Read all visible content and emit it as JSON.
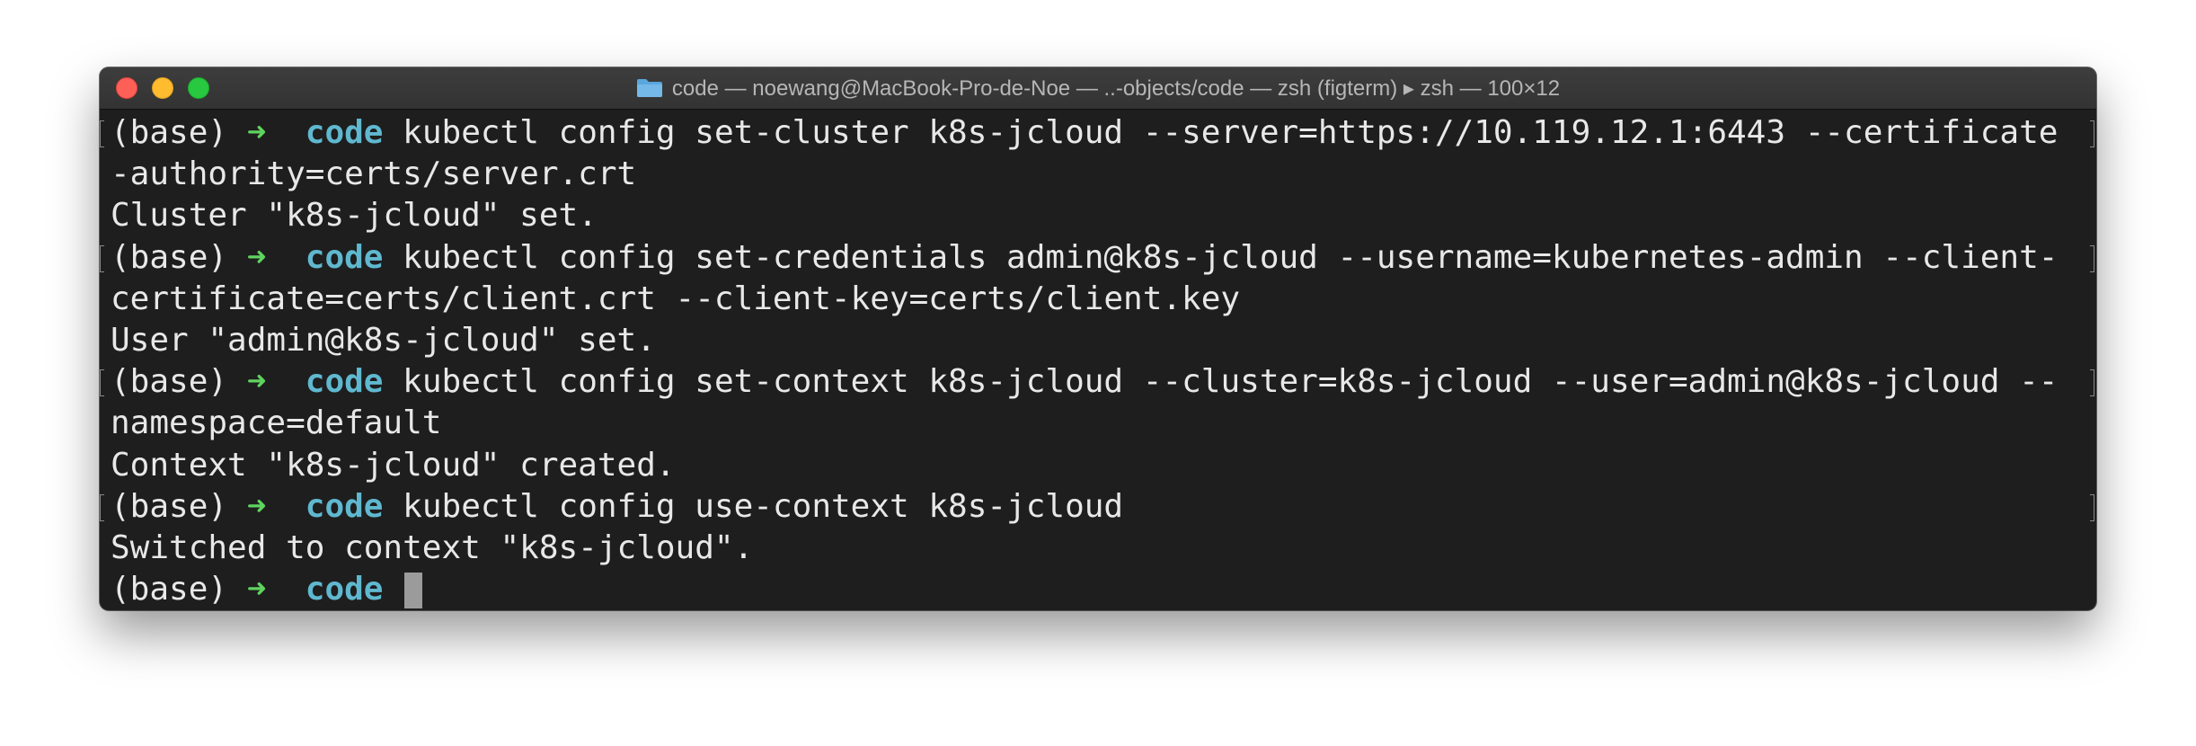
{
  "window": {
    "title": "code — noewang@MacBook-Pro-de-Noe — ..-objects/code — zsh (figterm) ▸ zsh — 100×12",
    "title_icon": "folder-icon",
    "traffic_lights": {
      "close_color": "#fe5f57",
      "minimize_color": "#febc2e",
      "maximize_color": "#28c840"
    }
  },
  "prompt": {
    "env": "(base)",
    "arrow": "➜",
    "dir": "code"
  },
  "terminal": {
    "lines": [
      {
        "type": "command",
        "text": "kubectl config set-cluster k8s-jcloud --server=https://10.119.12.1:6443 --certificate"
      },
      {
        "type": "output",
        "text": "-authority=certs/server.crt"
      },
      {
        "type": "output",
        "text": "Cluster \"k8s-jcloud\" set."
      },
      {
        "type": "command",
        "text": "kubectl config set-credentials admin@k8s-jcloud --username=kubernetes-admin --client-"
      },
      {
        "type": "output",
        "text": "certificate=certs/client.crt --client-key=certs/client.key"
      },
      {
        "type": "output",
        "text": "User \"admin@k8s-jcloud\" set."
      },
      {
        "type": "command",
        "text": "kubectl config set-context k8s-jcloud --cluster=k8s-jcloud --user=admin@k8s-jcloud --"
      },
      {
        "type": "output",
        "text": "namespace=default"
      },
      {
        "type": "output",
        "text": "Context \"k8s-jcloud\" created."
      },
      {
        "type": "command",
        "text": "kubectl config use-context k8s-jcloud"
      },
      {
        "type": "output",
        "text": "Switched to context \"k8s-jcloud\"."
      },
      {
        "type": "active-prompt",
        "text": ""
      }
    ]
  }
}
